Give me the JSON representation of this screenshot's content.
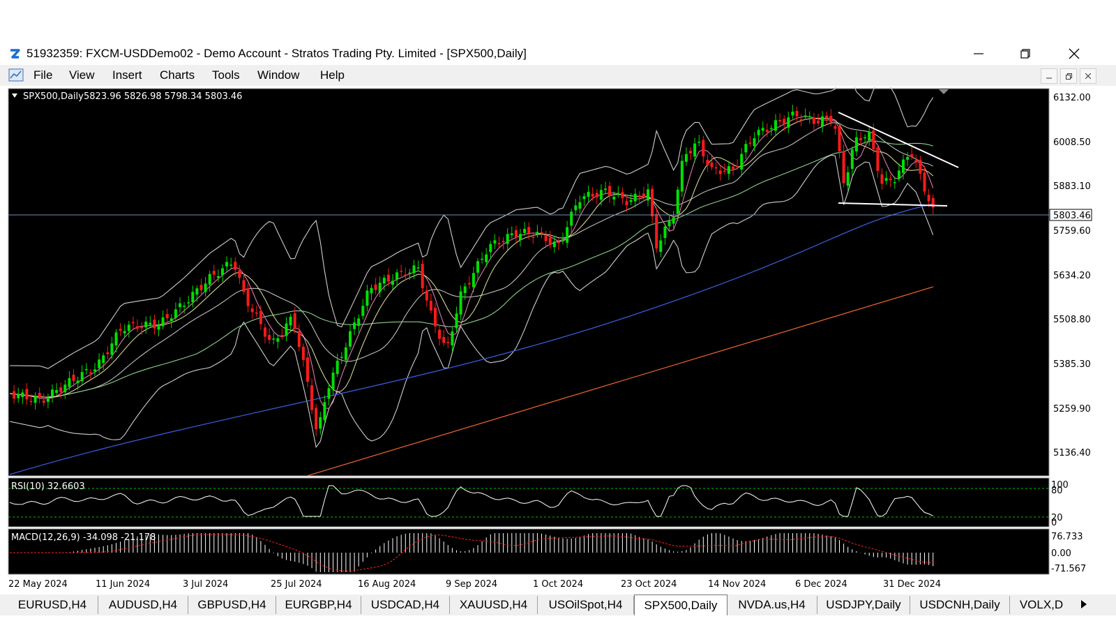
{
  "window": {
    "title": "51932359: FXCM-USDDemo02 - Demo Account - Stratos Trading Pty. Limited - [SPX500,Daily]"
  },
  "menu": {
    "items": [
      "File",
      "View",
      "Insert",
      "Charts",
      "Tools",
      "Window",
      "Help"
    ]
  },
  "chart": {
    "symbol_label": "SPX500,Daily",
    "ohlc_label": "5823.96 5826.98 5798.34 5803.46",
    "current_price_label": "5803.46",
    "price_axis_labels": [
      "6132.00",
      "6008.50",
      "5883.10",
      "5759.60",
      "5634.20",
      "5508.80",
      "5385.30",
      "5259.90",
      "5136.40"
    ],
    "date_labels": [
      "22 May 2024",
      "11 Jun 2024",
      "3 Jul 2024",
      "25 Jul 2024",
      "16 Aug 2024",
      "9 Sep 2024",
      "1 Oct 2024",
      "23 Oct 2024",
      "14 Nov 2024",
      "6 Dec 2024",
      "31 Dec 2024"
    ],
    "colors": {
      "background": "#000000",
      "bull_candle": "#00e000",
      "bear_candle": "#ff1a1a",
      "ma_blue": "#3a5bd9",
      "ma_orange": "#e0602a",
      "ma_green": "#8fd08f",
      "ma_pink": "#e07ab0",
      "bollinger": "#cfcfcf",
      "trendline": "#ffffff"
    }
  },
  "rsi": {
    "label": "RSI(10) 32.6603",
    "levels": [
      "100",
      "80",
      "20",
      "0"
    ],
    "value": 32.6603
  },
  "macd": {
    "label": "MACD(12,26,9) -34.098 -21.178",
    "axis_labels": [
      "76.733",
      "0.00",
      "-71.567"
    ]
  },
  "tabs": [
    {
      "label": "EURUSD,H4",
      "active": false
    },
    {
      "label": "AUDUSD,H4",
      "active": false
    },
    {
      "label": "GBPUSD,H4",
      "active": false
    },
    {
      "label": "EURGBP,H4",
      "active": false
    },
    {
      "label": "USDCAD,H4",
      "active": false
    },
    {
      "label": "XAUUSD,H4",
      "active": false
    },
    {
      "label": "USOilSpot,H4",
      "active": false
    },
    {
      "label": "SPX500,Daily",
      "active": true
    },
    {
      "label": "NVDA.us,H4",
      "active": false
    },
    {
      "label": "USDJPY,Daily",
      "active": false
    },
    {
      "label": "USDCNH,Daily",
      "active": false
    },
    {
      "label": "VOLX,D",
      "active": false
    }
  ]
}
